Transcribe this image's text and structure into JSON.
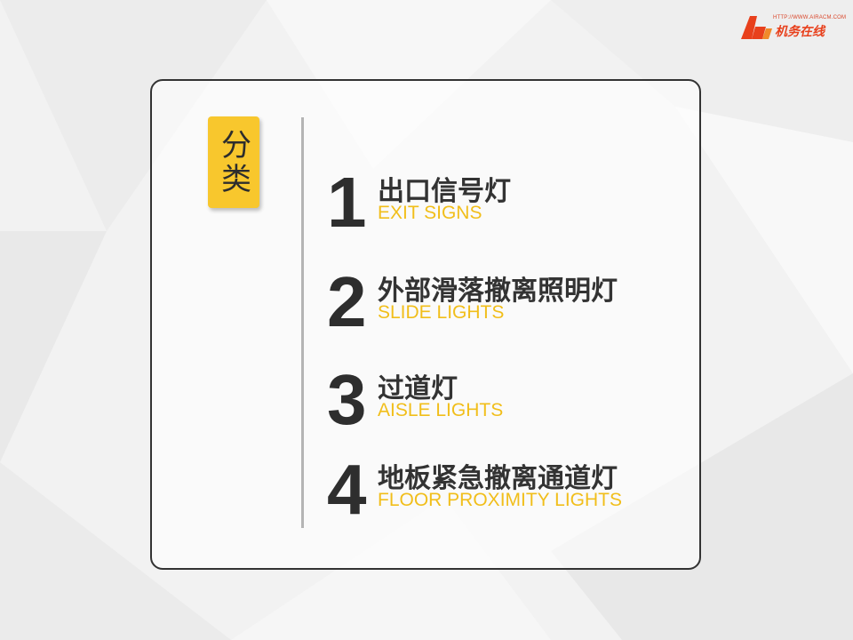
{
  "logo": {
    "url": "HTTP://WWW.AIRACM.COM",
    "name": "机务在线",
    "mark": "AC"
  },
  "category": {
    "label": "分类"
  },
  "items": [
    {
      "number": "1",
      "zh": "出口信号灯",
      "en": "EXIT SIGNS"
    },
    {
      "number": "2",
      "zh": "外部滑落撤离照明灯",
      "en": "SLIDE LIGHTS"
    },
    {
      "number": "3",
      "zh": "过道灯",
      "en": "AISLE LIGHTS"
    },
    {
      "number": "4",
      "zh": "地板紧急撤离通道灯",
      "en": "FLOOR PROXIMITY LIGHTS"
    }
  ],
  "colors": {
    "accent": "#f1be1a",
    "tag_bg": "#f8c72d",
    "text_dark": "#333333",
    "logo_red": "#e8401c"
  }
}
